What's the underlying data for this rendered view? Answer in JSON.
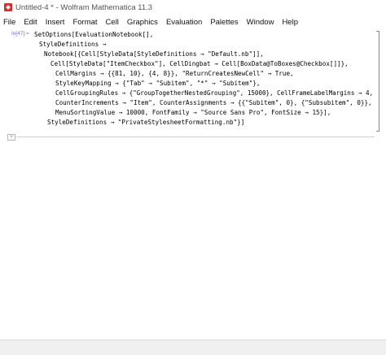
{
  "window": {
    "title": "Untitled-4 * - Wolfram Mathematica 11.3",
    "icon": "mathematica-icon"
  },
  "menubar": {
    "items": [
      "File",
      "Edit",
      "Insert",
      "Format",
      "Cell",
      "Graphics",
      "Evaluation",
      "Palettes",
      "Window",
      "Help"
    ]
  },
  "notebook": {
    "cell_label": "In[47]:=",
    "lines": [
      "SetOptions[EvaluationNotebook[],",
      "StyleDefinitions →",
      "Notebook[{Cell[StyleData[StyleDefinitions → \"Default.nb\"]],",
      "Cell[StyleData[\"ItemCheckbox\"], CellDingbat → Cell[BoxData@ToBoxes@Checkbox[]]},",
      "CellMargins → {{81, 10}, {4, 8}}, \"ReturnCreatesNewCell\" → True,",
      "StyleKeyMapping → {\"Tab\" → \"Subitem\", \"*\" → \"Subitem\"},",
      "CellGroupingRules → {\"GroupTogetherNestedGrouping\", 15000}, CellFrameLabelMargins → 4,",
      "CounterIncrements → \"Item\", CounterAssignments → {{\"Subitem\", 0}, {\"Subsubitem\", 0}},",
      "MenuSortingValue → 10000, FontFamily → \"Source Sans Pro\", FontSize → 15}],",
      "StyleDefinitions → \"PrivateStylesheetFormatting.nb\"}]"
    ]
  },
  "colors": {
    "cell_label": "#6e6edb",
    "string": "#666666",
    "text": "#000000"
  }
}
